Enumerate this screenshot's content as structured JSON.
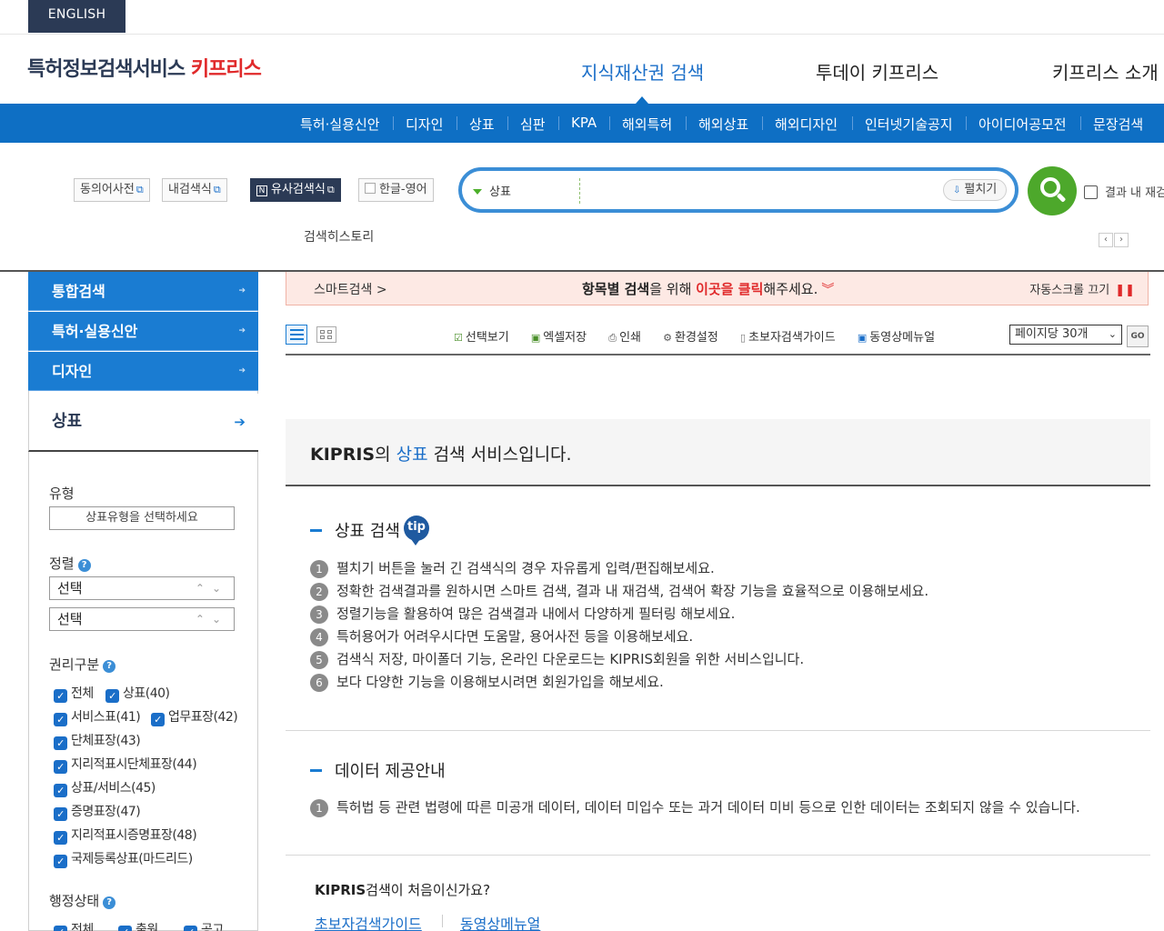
{
  "util": {
    "lang_button": "ENGLISH"
  },
  "logo": {
    "main": "특허정보검색서비스",
    "brand": "키프리스"
  },
  "main_nav": {
    "search": "지식재산권 검색",
    "today": "투데이 키프리스",
    "about": "키프리스 소개"
  },
  "sub_nav": [
    "특허·실용신안",
    "디자인",
    "상표",
    "심판",
    "KPA",
    "해외특허",
    "해외상표",
    "해외디자인",
    "인터넷기술공지",
    "아이디어공모전",
    "문장검색"
  ],
  "search_tools": {
    "synonym": "동의어사전",
    "my_query": "내검색식",
    "similar": "유사검색식",
    "translate": "한글-영어"
  },
  "search": {
    "category": "상표",
    "placeholder": "",
    "expand": "펼치기",
    "within_results": "결과 내 재검색",
    "history": "검색히스토리"
  },
  "sidebar": {
    "items": [
      "통합검색",
      "특허·실용신안",
      "디자인"
    ],
    "active": "상표",
    "type_label": "유형",
    "type_select": "상표유형을 선택하세요",
    "sort_label": "정렬",
    "sort_1": "선택",
    "sort_2": "선택",
    "rights_label": "권리구분",
    "checks": [
      "전체",
      "상표(40)",
      "서비스표(41)",
      "업무표장(42)",
      "단체표장(43)",
      "지리적표시단체표장(44)",
      "상표/서비스(45)",
      "증명표장(47)",
      "지리적표시증명표장(48)",
      "국제등록상표(마드리드)"
    ],
    "status_label": "행정상태",
    "status_checks": [
      "전체",
      "출원",
      "공고"
    ]
  },
  "smart_bar": {
    "label": "스마트검색 >",
    "msg_1": "항목별 검색",
    "msg_2": "을 위해 ",
    "msg_red": "이곳을 클릭",
    "msg_3": "해주세요.",
    "auto_scroll": "자동스크롤 끄기"
  },
  "toolbar": {
    "select_view": "선택보기",
    "excel": "엑셀저장",
    "print": "인쇄",
    "settings": "환경설정",
    "beginner": "초보자검색가이드",
    "video": "동영상메뉴얼",
    "per_page": "페이지당 30개",
    "go": "GO"
  },
  "intro": {
    "kipris": "KIPRIS",
    "p1": "의 ",
    "tm": "상표",
    "p2": " 검색 서비스입니다."
  },
  "tip_section": {
    "title": "상표 검색",
    "badge": "tip",
    "lines": [
      "펼치기 버튼을 눌러 긴 검색식의 경우 자유롭게 입력/편집해보세요.",
      "정확한 검색결과를 원하시면 스마트 검색, 결과 내 재검색, 검색어 확장 기능을 효율적으로 이용해보세요.",
      "정렬기능을 활용하여 많은 검색결과 내에서 다양하게 필터링 해보세요.",
      "특허용어가 어려우시다면 도움말, 용어사전 등을 이용해보세요.",
      "검색식 저장, 마이폴더 기능, 온라인 다운로드는 KIPRIS회원을 위한 서비스입니다.",
      "보다 다양한 기능을 이용해보시려면 회원가입을 해보세요."
    ]
  },
  "data_section": {
    "title": "데이터 제공안내",
    "line": "특허법 등 관련 법령에 따른 미공개 데이터, 데이터 미입수 또는 과거 데이터 미비 등으로 인한 데이터는 조회되지 않을 수 있습니다."
  },
  "first_time": {
    "kipris": "KIPRIS",
    "rest": "검색이 처음이신가요?",
    "guide": "초보자검색가이드",
    "video": "동영상메뉴얼"
  },
  "colors": {
    "brand_blue": "#0e6fc4",
    "brand_red": "#e0292a",
    "search_green": "#4da82b"
  }
}
